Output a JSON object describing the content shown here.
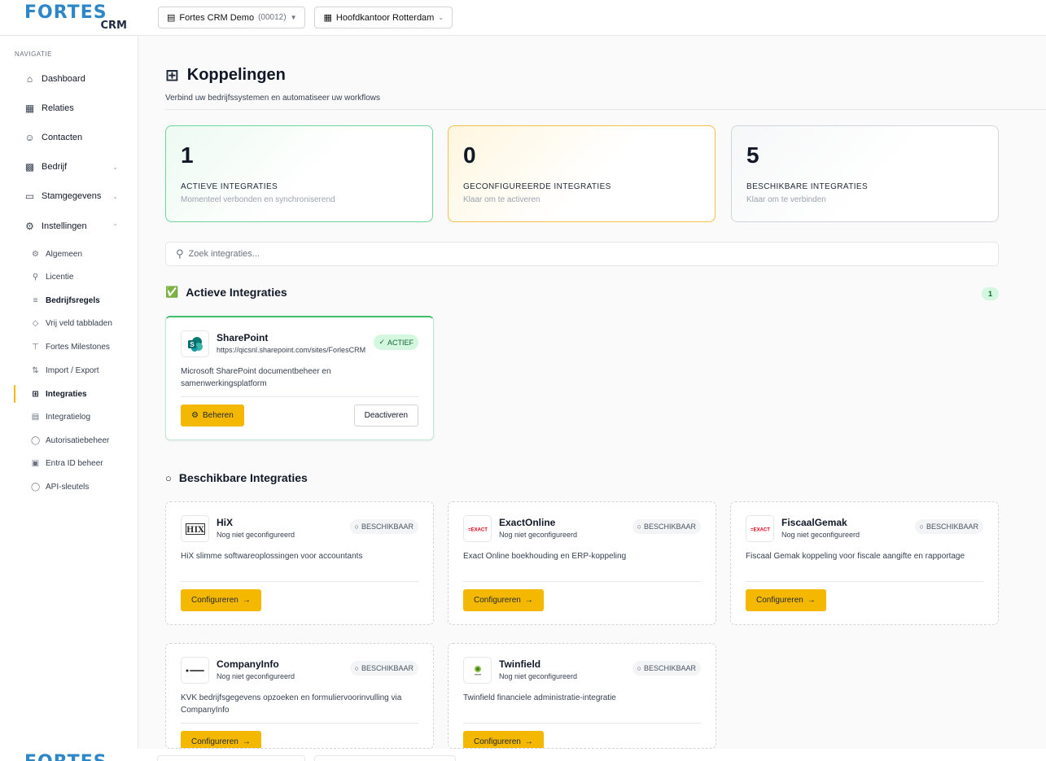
{
  "logo": {
    "main": "FORTES",
    "sub": "CRM"
  },
  "topbar": {
    "org": {
      "name": "Fortes CRM Demo",
      "code": "(00012)"
    },
    "office": {
      "name": "Hoofdkantoor Rotterdam"
    }
  },
  "sidebar": {
    "section_title": "NAVIGATIE",
    "items": [
      {
        "label": "Dashboard",
        "icon": "home-icon"
      },
      {
        "label": "Relaties",
        "icon": "building-icon"
      },
      {
        "label": "Contacten",
        "icon": "users-icon"
      },
      {
        "label": "Bedrijf",
        "icon": "company-icon"
      },
      {
        "label": "Stamgegevens",
        "icon": "folder-icon"
      },
      {
        "label": "Instellingen",
        "icon": "gear-icon"
      }
    ],
    "sub_items": [
      {
        "label": "Algemeen",
        "icon": "gear-icon"
      },
      {
        "label": "Licentie",
        "icon": "user-key-icon"
      },
      {
        "label": "Bedrijfsregels",
        "icon": "sliders-icon"
      },
      {
        "label": "Vrij veld tabbladen",
        "icon": "tag-icon"
      },
      {
        "label": "Fortes Milestones",
        "icon": "signpost-icon"
      },
      {
        "label": "Import / Export",
        "icon": "arrows-icon"
      },
      {
        "label": "Integraties",
        "icon": "grid-plus-icon"
      },
      {
        "label": "Integratielog",
        "icon": "file-text-icon"
      },
      {
        "label": "Autorisatiebeheer",
        "icon": "shield-icon"
      },
      {
        "label": "Entra ID beheer",
        "icon": "id-card-icon"
      },
      {
        "label": "API-sleutels",
        "icon": "shield-icon"
      }
    ]
  },
  "page": {
    "title": "Koppelingen",
    "subtitle": "Verbind uw bedrijfssystemen en automatiseer uw workflows"
  },
  "stats": [
    {
      "value": "1",
      "label": "ACTIEVE INTEGRATIES",
      "desc": "Momenteel verbonden en synchroniserend"
    },
    {
      "value": "0",
      "label": "GECONFIGUREERDE INTEGRATIES",
      "desc": "Klaar om te activeren"
    },
    {
      "value": "5",
      "label": "BESCHIKBARE INTEGRATIES",
      "desc": "Klaar om te verbinden"
    }
  ],
  "search": {
    "placeholder": "Zoek integraties..."
  },
  "active_section": {
    "title": "Actieve Integraties",
    "count": "1"
  },
  "active_integrations": [
    {
      "name": "SharePoint",
      "url": "https://qicsnl.sharepoint.com/sites/ForlesCRM",
      "badge": "ACTIEF",
      "desc": "Microsoft SharePoint documentbeheer en samenwerkingsplatform",
      "manage_label": "Beheren",
      "deactivate_label": "Deactiveren"
    }
  ],
  "available_section": {
    "title": "Beschikbare Integraties"
  },
  "available_integrations": [
    {
      "name": "HiX",
      "status": "Nog niet geconfigureerd",
      "badge": "BESCHIKBAAR",
      "desc": "HiX slimme softwareoplossingen voor accountants",
      "button": "Configureren"
    },
    {
      "name": "ExactOnline",
      "status": "Nog niet geconfigureerd",
      "badge": "BESCHIKBAAR",
      "desc": "Exact Online boekhouding en ERP-koppeling",
      "button": "Configureren"
    },
    {
      "name": "FiscaalGemak",
      "status": "Nog niet geconfigureerd",
      "badge": "BESCHIKBAAR",
      "desc": "Fiscaal Gemak koppeling voor fiscale aangifte en rapportage",
      "button": "Configureren"
    },
    {
      "name": "CompanyInfo",
      "status": "Nog niet geconfigureerd",
      "badge": "BESCHIKBAAR",
      "desc": "KVK bedrijfsgegevens opzoeken en formuliervoorinvulling via CompanyInfo",
      "button": "Configureren"
    },
    {
      "name": "Twinfield",
      "status": "Nog niet geconfigureerd",
      "badge": "BESCHIKBAAR",
      "desc": "Twinfield financiele administratie-integratie",
      "button": "Configureren"
    }
  ],
  "colors": {
    "brand_blue": "#2c86c7",
    "accent_yellow": "#f5b800",
    "success_green": "#3fbf6e"
  }
}
